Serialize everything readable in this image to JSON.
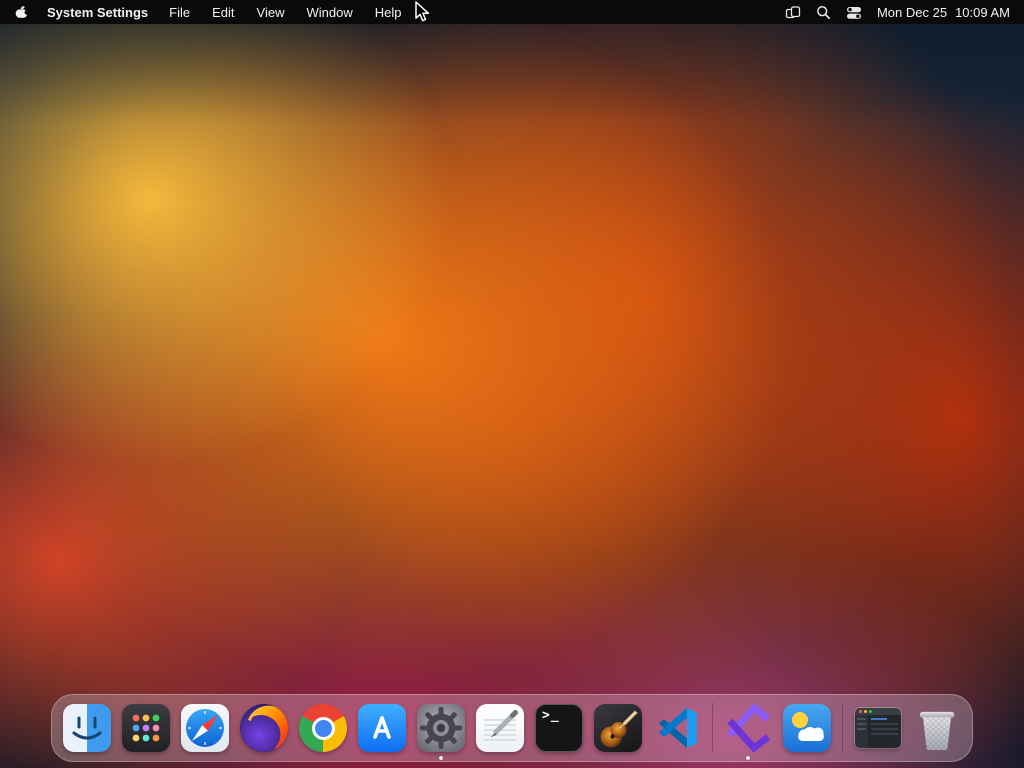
{
  "menu_bar": {
    "app_name": "System Settings",
    "menus": [
      {
        "label": "File"
      },
      {
        "label": "Edit"
      },
      {
        "label": "View"
      },
      {
        "label": "Window"
      },
      {
        "label": "Help"
      }
    ],
    "status_icons": [
      {
        "name": "window-stack"
      },
      {
        "name": "spotlight-search"
      },
      {
        "name": "control-center"
      }
    ],
    "clock_date": "Mon Dec 25",
    "clock_time": "10:09 AM"
  },
  "dock": {
    "terminal_glyph": ">_",
    "items": [
      {
        "name": "finder",
        "running": false
      },
      {
        "name": "launchpad",
        "running": false
      },
      {
        "name": "safari",
        "running": false
      },
      {
        "name": "firefox",
        "running": false
      },
      {
        "name": "chrome",
        "running": false
      },
      {
        "name": "app-store",
        "running": false
      },
      {
        "name": "system-settings",
        "running": true
      },
      {
        "name": "textedit",
        "running": false
      },
      {
        "name": "terminal",
        "running": false
      },
      {
        "name": "garageband",
        "running": false
      },
      {
        "name": "vscode",
        "running": false
      },
      {
        "name": "separator"
      },
      {
        "name": "visual-studio",
        "running": true
      },
      {
        "name": "weather",
        "running": false
      },
      {
        "name": "separator"
      },
      {
        "name": "minimized-window",
        "running": false
      },
      {
        "name": "trash",
        "running": false
      }
    ]
  },
  "colors": {
    "menu_bar_bg": "#0a0a0b",
    "wallpaper_orange": "#f57c16",
    "wallpaper_navy": "#152638",
    "dock_bg": "rgba(178,178,190,0.38)"
  }
}
